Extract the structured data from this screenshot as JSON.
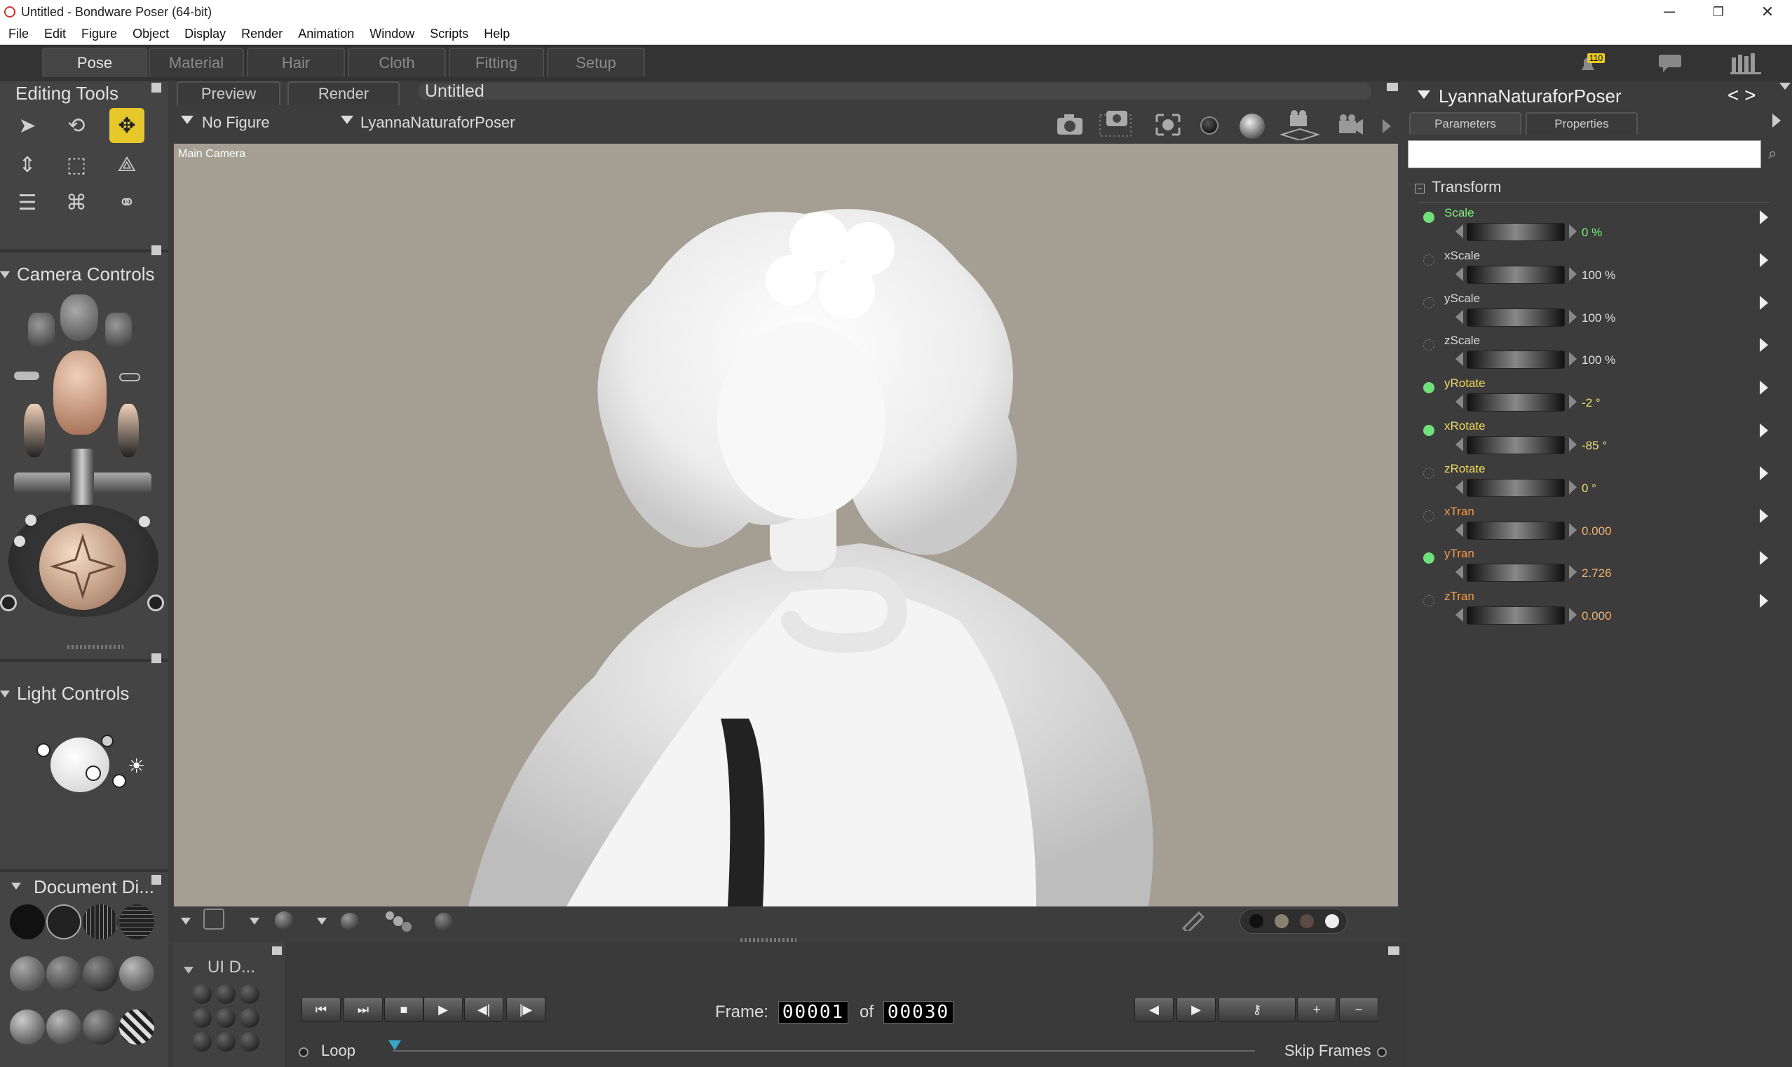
{
  "window": {
    "title": "Untitled - Bondware Poser (64-bit)",
    "minimize": "─",
    "maximize": "❐",
    "close": "✕"
  },
  "menu": [
    "File",
    "Edit",
    "Figure",
    "Object",
    "Display",
    "Render",
    "Animation",
    "Window",
    "Scripts",
    "Help"
  ],
  "rooms": [
    {
      "label": "Pose",
      "active": true
    },
    {
      "label": "Material"
    },
    {
      "label": "Hair"
    },
    {
      "label": "Cloth"
    },
    {
      "label": "Fitting"
    },
    {
      "label": "Setup"
    }
  ],
  "notifications": {
    "count": "110"
  },
  "editing_tools": {
    "title": "Editing Tools"
  },
  "camera_controls": {
    "title": "Camera Controls"
  },
  "light_controls": {
    "title": "Light Controls"
  },
  "document_display": {
    "title": "Document Di..."
  },
  "ui_dots": {
    "title": "UI D..."
  },
  "document": {
    "tabs": {
      "preview": "Preview",
      "render": "Render"
    },
    "name": "Untitled",
    "figure_selector": "No Figure",
    "actor_selector": "LyannaNaturaforPoser",
    "camera_label": "Main Camera"
  },
  "parameters_panel": {
    "actor": "LyannaNaturaforPoser",
    "nav": "< >",
    "tabs": {
      "parameters": "Parameters",
      "properties": "Properties"
    },
    "search_placeholder": "",
    "group": "Transform",
    "params": [
      {
        "name": "Scale",
        "value": "0 %",
        "active": true,
        "color": "#7cf07c",
        "vcolor": "#7cf07c"
      },
      {
        "name": "xScale",
        "value": "100 %",
        "active": false,
        "color": "#d8d8d8",
        "vcolor": "#e0e0e0"
      },
      {
        "name": "yScale",
        "value": "100 %",
        "active": false,
        "color": "#d8d8d8",
        "vcolor": "#e0e0e0"
      },
      {
        "name": "zScale",
        "value": "100 %",
        "active": false,
        "color": "#d8d8d8",
        "vcolor": "#e0e0e0"
      },
      {
        "name": "yRotate",
        "value": "-2 °",
        "active": true,
        "color": "#f0d860",
        "vcolor": "#f0e070"
      },
      {
        "name": "xRotate",
        "value": "-85 °",
        "active": true,
        "color": "#f0d860",
        "vcolor": "#f0e070"
      },
      {
        "name": "zRotate",
        "value": "0 °",
        "active": false,
        "color": "#f0d860",
        "vcolor": "#f0e070"
      },
      {
        "name": "xTran",
        "value": "0.000",
        "active": false,
        "color": "#f09a50",
        "vcolor": "#f0b070"
      },
      {
        "name": "yTran",
        "value": "2.726",
        "active": true,
        "color": "#f09a50",
        "vcolor": "#f0b070"
      },
      {
        "name": "zTran",
        "value": "0.000",
        "active": false,
        "color": "#f09a50",
        "vcolor": "#f0b070"
      }
    ]
  },
  "animation": {
    "frame_label": "Frame:",
    "current": "00001",
    "of_label": "of",
    "total": "00030",
    "loop": "Loop",
    "skip_frames": "Skip Frames"
  },
  "colors": {
    "accent": "#e6c82a",
    "viewport_bg": "#a59f93",
    "panel": "#444444"
  }
}
